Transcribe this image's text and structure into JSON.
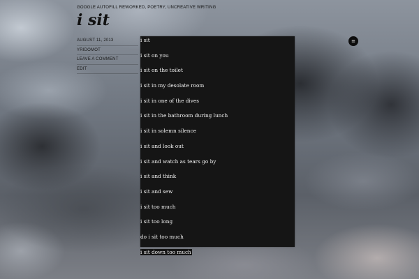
{
  "header": {
    "categories": "GOOGLE AUTOFILL REWORKED, POETRY, UNCREATIVE WRITING"
  },
  "post": {
    "title": "i sit",
    "date": "AUGUST 11, 2013",
    "author": "YRIDOMOT",
    "comment_link": "LEAVE A COMMENT",
    "edit_link": "EDIT",
    "lines": [
      "i sit",
      "i sit on you",
      "i sit on the toilet",
      "i sit in my desolate room",
      "i sit in one of the dives",
      "i sit in the bathroom during lunch",
      "i sit in solemn silence",
      "i sit and look out",
      "i sit and watch as tears go by",
      "i sit and think",
      "i sit and sew",
      "i sit too much",
      "i sit too long",
      "do i sit too much",
      "i sit down too much"
    ]
  },
  "menu_button": {
    "icon": "menu-icon",
    "glyph": "≡"
  },
  "colors": {
    "poem_background": "#151515",
    "poem_text": "#f2f2f2",
    "title_text": "#111111"
  }
}
